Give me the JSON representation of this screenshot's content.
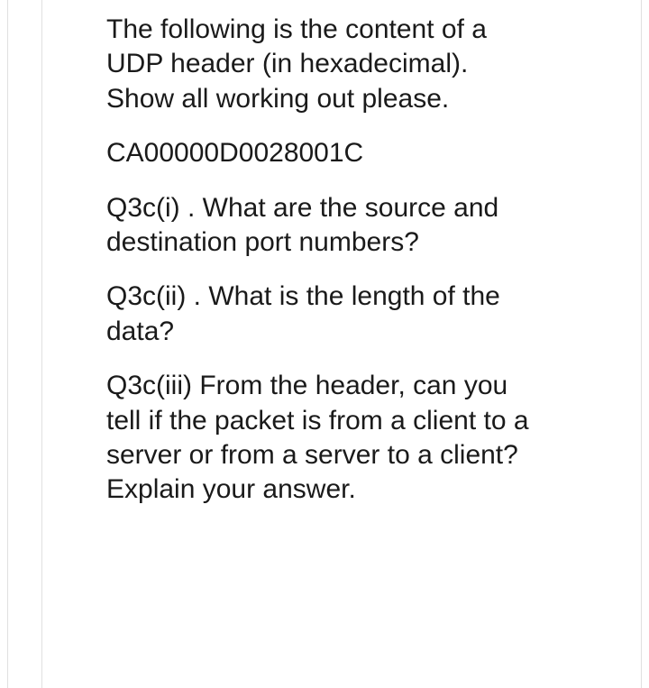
{
  "question": {
    "intro": "The following is the content of a UDP header (in hexadecimal). Show all working out please.",
    "hex": "CA00000D0028001C",
    "q1": "Q3c(i) . What are the source and destination port numbers?",
    "q2": "Q3c(ii) . What is the length of the data?",
    "q3": "Q3c(iii) From the header, can you tell if the packet is from a client to a server or from a server to a client? Explain your answer."
  }
}
